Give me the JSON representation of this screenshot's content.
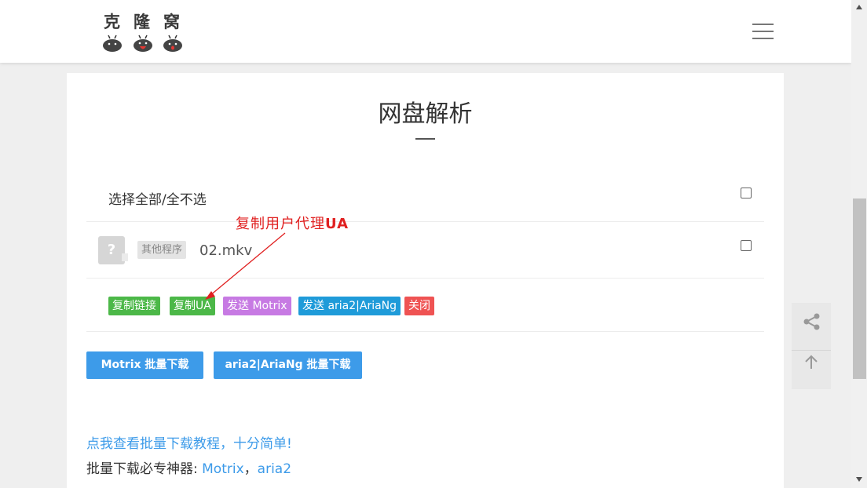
{
  "header": {
    "logo_text": "克隆窝",
    "menu_icon": "hamburger-menu-icon"
  },
  "main": {
    "title": "网盘解析",
    "select_all_label": "选择全部/全不选",
    "file": {
      "tag": "其他程序",
      "name": "02.mkv",
      "thumb_icon": "?"
    },
    "actions": [
      {
        "label": "复制链接",
        "color": "#4cb848"
      },
      {
        "label": "复制UA",
        "color": "#4cb848"
      },
      {
        "label": "发送 Motrix",
        "color": "#c77ae3"
      },
      {
        "label": "发送 aria2|AriaNg",
        "color": "#1f9bd9"
      },
      {
        "label": "关闭",
        "color": "#ef5353"
      }
    ],
    "batch_buttons": {
      "motrix": "Motrix 批量下载",
      "aria2": "aria2|AriaNg 批量下载"
    },
    "annotation": {
      "prefix": "复制用户代理",
      "bold": "UA"
    },
    "tutorial_link": "点我查看批量下载教程，十分简单!",
    "tools": {
      "prefix": "批量下载必专神器: ",
      "motrix": "Motrix",
      "separator": "，",
      "aria2": "aria2"
    }
  },
  "side": {
    "share_icon": "share-icon",
    "top_icon": "arrow-up-icon"
  },
  "colors": {
    "accent": "#3d9be9",
    "annotation": "#e02020"
  }
}
